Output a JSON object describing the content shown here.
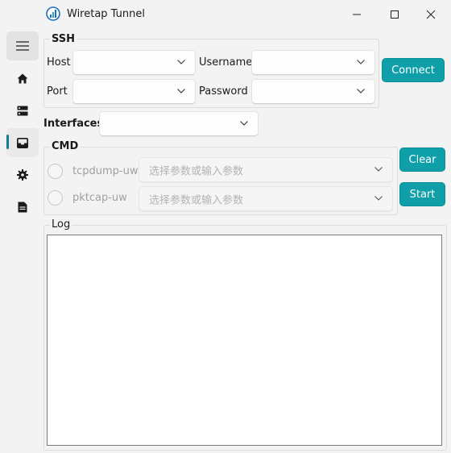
{
  "window": {
    "title": "Wiretap Tunnel"
  },
  "sidebar": {
    "items": [
      {
        "icon": "hamburger-menu-icon"
      },
      {
        "icon": "home-icon"
      },
      {
        "icon": "server-icon"
      },
      {
        "icon": "inbox-icon"
      },
      {
        "icon": "gear-icon"
      },
      {
        "icon": "document-icon"
      }
    ],
    "active_index": 3,
    "accent": "#0f7d96"
  },
  "ssh": {
    "group_title": "SSH",
    "host_label": "Host",
    "username_label": "Username",
    "port_label": "Port",
    "password_label": "Password",
    "host_value": "",
    "username_value": "",
    "port_value": "",
    "password_value": "",
    "connect_label": "Connect"
  },
  "interfaces": {
    "label": "Interfaces",
    "value": ""
  },
  "cmd": {
    "group_title": "CMD",
    "options": [
      {
        "label": "tcpdump-uw",
        "placeholder": "选择参数或输入参数"
      },
      {
        "label": "pktcap-uw",
        "placeholder": "选择参数或输入参数"
      }
    ],
    "clear_label": "Clear",
    "start_label": "Start"
  },
  "log": {
    "group_title": "Log",
    "content": ""
  },
  "colors": {
    "accent_button": "#0e9fa9",
    "background": "#f3f3f3"
  }
}
